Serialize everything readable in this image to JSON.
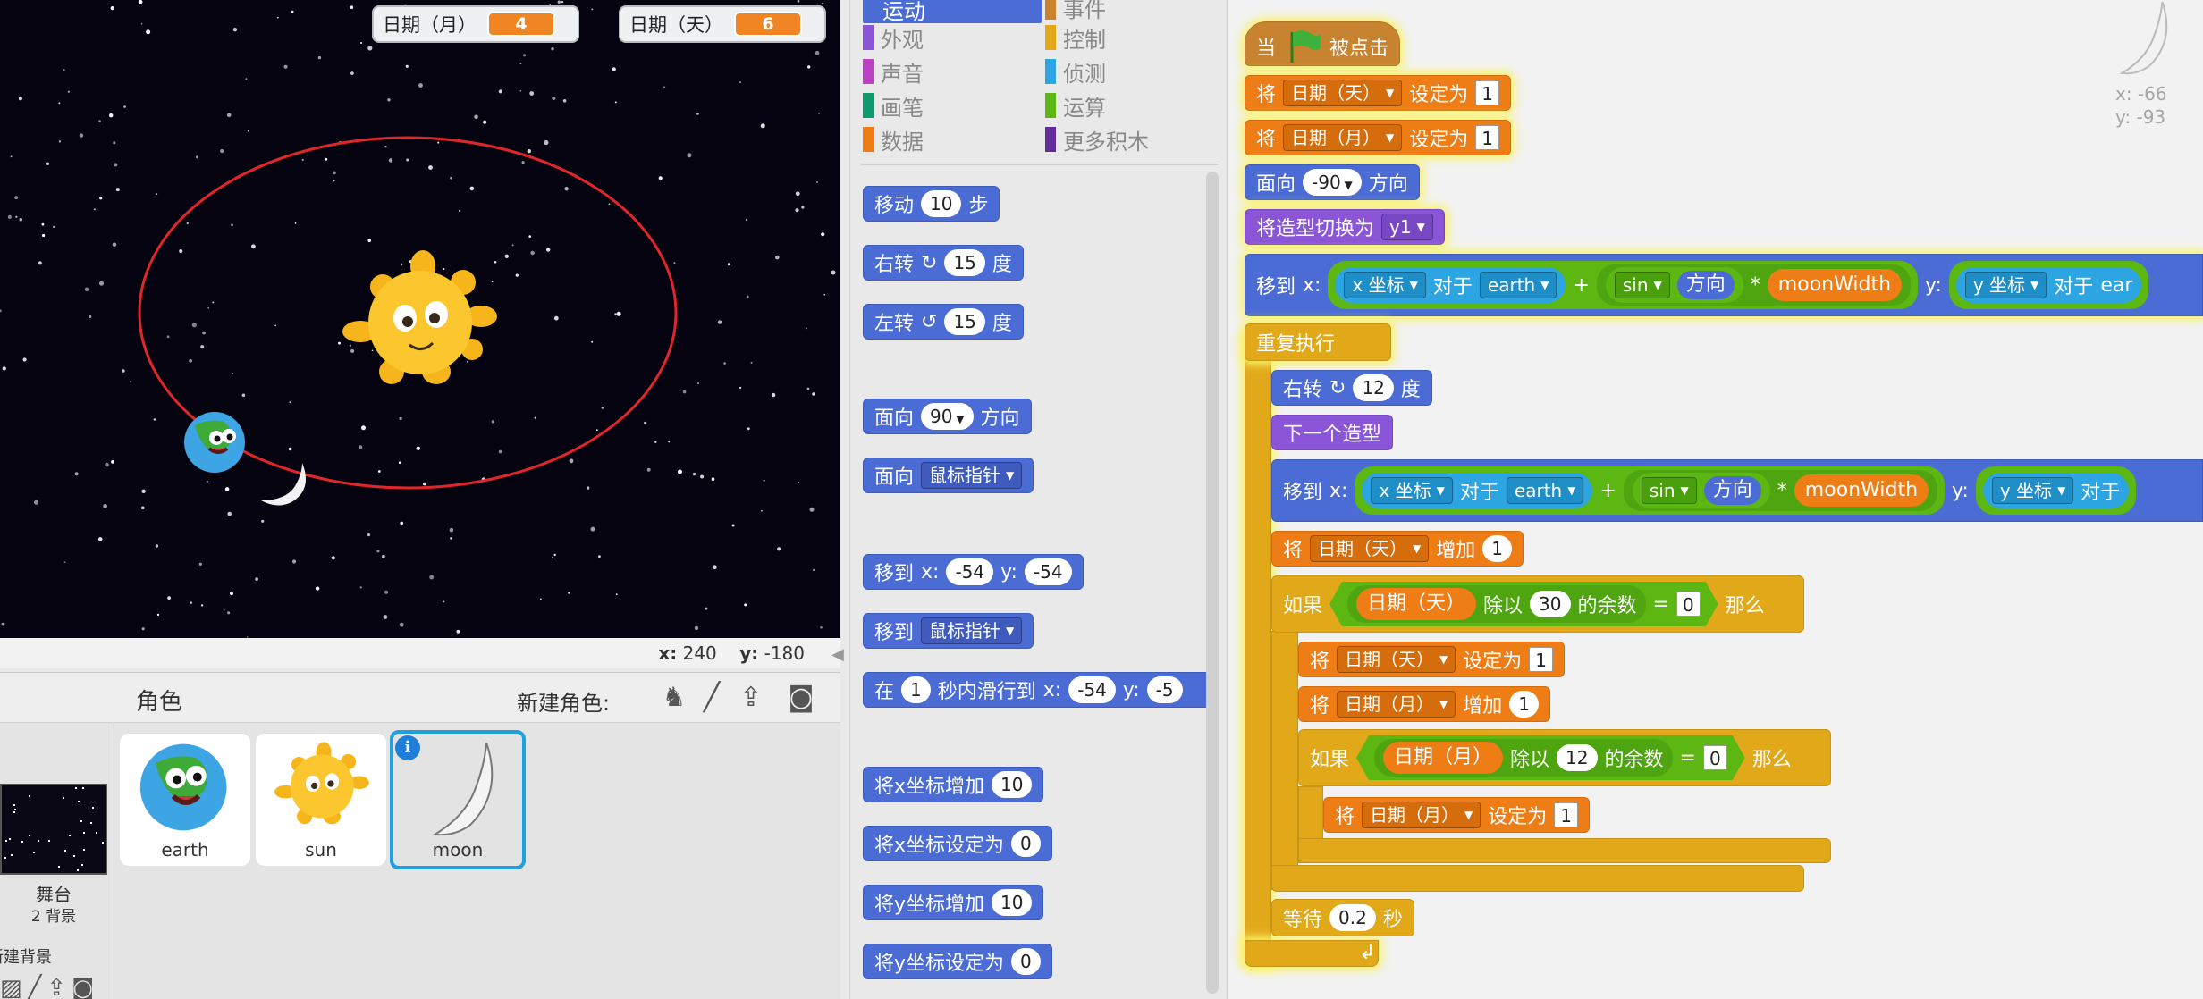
{
  "stage": {
    "monitor_month_label": "日期（月）",
    "monitor_month_value": "4",
    "monitor_day_label": "日期（天）",
    "monitor_day_value": "6",
    "mouse_x_label": "x:",
    "mouse_x_value": "240",
    "mouse_y_label": "y:",
    "mouse_y_value": "-180"
  },
  "sprite_pane": {
    "title": "角色",
    "new_sprite_label": "新建角色:",
    "stage_label": "舞台",
    "stage_backdrops": "2 背景",
    "new_backdrop_label": "新建背景",
    "sprites": [
      {
        "name": "earth"
      },
      {
        "name": "sun"
      },
      {
        "name": "moon"
      }
    ]
  },
  "categories": {
    "left": [
      {
        "label": "运动",
        "color": "#4a6cd4"
      },
      {
        "label": "外观",
        "color": "#8a55d7"
      },
      {
        "label": "声音",
        "color": "#bb42c3"
      },
      {
        "label": "画笔",
        "color": "#0e9a6c"
      },
      {
        "label": "数据",
        "color": "#ee7d16"
      }
    ],
    "right": [
      {
        "label": "事件",
        "color": "#c88330"
      },
      {
        "label": "控制",
        "color": "#e1a91a"
      },
      {
        "label": "侦测",
        "color": "#2ca5e2"
      },
      {
        "label": "运算",
        "color": "#5cb712"
      },
      {
        "label": "更多积木",
        "color": "#632d99"
      }
    ]
  },
  "palette": {
    "move": {
      "a": "移动",
      "n": "10",
      "b": "步"
    },
    "turn_right": {
      "a": "右转",
      "n": "15",
      "b": "度"
    },
    "turn_left": {
      "a": "左转",
      "n": "15",
      "b": "度"
    },
    "point_dir": {
      "a": "面向",
      "n": "90",
      "b": "方向"
    },
    "point_towards": {
      "a": "面向",
      "dd": "鼠标指针"
    },
    "goto_xy": {
      "a": "移到",
      "x": "x:",
      "xv": "-54",
      "y": "y:",
      "yv": "-54"
    },
    "goto_target": {
      "a": "移到",
      "dd": "鼠标指针"
    },
    "glide": {
      "a": "在",
      "n": "1",
      "b": "秒内滑行到",
      "x": "x:",
      "xv": "-54",
      "y": "y:",
      "yv": "-5"
    },
    "change_x": {
      "a": "将x坐标增加",
      "n": "10"
    },
    "set_x": {
      "a": "将x坐标设定为",
      "n": "0"
    },
    "change_y": {
      "a": "将y坐标增加",
      "n": "10"
    },
    "set_y": {
      "a": "将y坐标设定为",
      "n": "0"
    }
  },
  "script": {
    "hat": {
      "a": "当",
      "b": "被点击"
    },
    "set_day": {
      "a": "将",
      "var": "日期（天）",
      "b": "设定为",
      "v": "1"
    },
    "set_month": {
      "a": "将",
      "var": "日期（月）",
      "b": "设定为",
      "v": "1"
    },
    "point": {
      "a": "面向",
      "n": "-90",
      "b": "方向"
    },
    "costume": {
      "a": "将造型切换为",
      "dd": "y1"
    },
    "goto1": {
      "a": "移到",
      "x": "x:",
      "attr": "x 坐标",
      "of": "对于",
      "obj": "earth",
      "plus": "+",
      "fn": "sin",
      "dir": "方向",
      "times": "*",
      "var": "moonWidth",
      "y": "y:",
      "attr2": "y 坐标",
      "of2": "对于",
      "obj2": "ear"
    },
    "forever": {
      "a": "重复执行"
    },
    "turn": {
      "a": "右转",
      "n": "12",
      "b": "度"
    },
    "next_costume": {
      "a": "下一个造型"
    },
    "goto2": {
      "a": "移到",
      "x": "x:",
      "attr": "x 坐标",
      "of": "对于",
      "obj": "earth",
      "plus": "+",
      "fn": "sin",
      "dir": "方向",
      "times": "*",
      "var": "moonWidth",
      "y": "y:",
      "attr2": "y 坐标",
      "of2": "对于"
    },
    "change_day": {
      "a": "将",
      "var": "日期（天）",
      "b": "增加",
      "v": "1"
    },
    "if1": {
      "a": "如果",
      "var": "日期（天）",
      "mod": "除以",
      "n": "30",
      "rem": "的余数",
      "eq": "=",
      "v": "0",
      "then": "那么"
    },
    "set_day2": {
      "a": "将",
      "var": "日期（天）",
      "b": "设定为",
      "v": "1"
    },
    "change_month": {
      "a": "将",
      "var": "日期（月）",
      "b": "增加",
      "v": "1"
    },
    "if2": {
      "a": "如果",
      "var": "日期（月）",
      "mod": "除以",
      "n": "12",
      "rem": "的余数",
      "eq": "=",
      "v": "0",
      "then": "那么"
    },
    "set_month2": {
      "a": "将",
      "var": "日期（月）",
      "b": "设定为",
      "v": "1"
    },
    "wait": {
      "a": "等待",
      "n": "0.2",
      "b": "秒"
    }
  },
  "sprite_info": {
    "x": "x: -66",
    "y": "y: -93"
  }
}
